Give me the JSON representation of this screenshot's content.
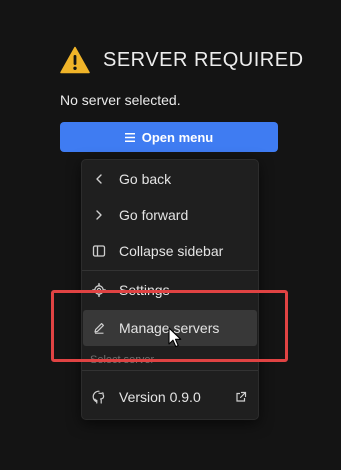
{
  "header": {
    "warning_icon": "warning-triangle-icon",
    "title": "SERVER REQUIRED",
    "subtitle": "No server selected.",
    "accent_color": "#f0b429"
  },
  "open_button": {
    "label": "Open menu",
    "icon": "hamburger-icon",
    "color": "#3f7cf2"
  },
  "menu": {
    "items": [
      {
        "label": "Go back",
        "icon": "chevron-left-icon"
      },
      {
        "label": "Go forward",
        "icon": "chevron-right-icon"
      },
      {
        "label": "Collapse sidebar",
        "icon": "sidebar-icon"
      },
      {
        "label": "Settings",
        "icon": "gear-icon"
      },
      {
        "label": "Manage servers",
        "icon": "pencil-icon",
        "state": "hovered"
      },
      {
        "label": "Version 0.9.0",
        "icon": "github-icon",
        "trailing_icon": "external-link-icon"
      }
    ],
    "group_label": "Select server"
  },
  "annotation": {
    "highlight_color": "#e04343"
  }
}
